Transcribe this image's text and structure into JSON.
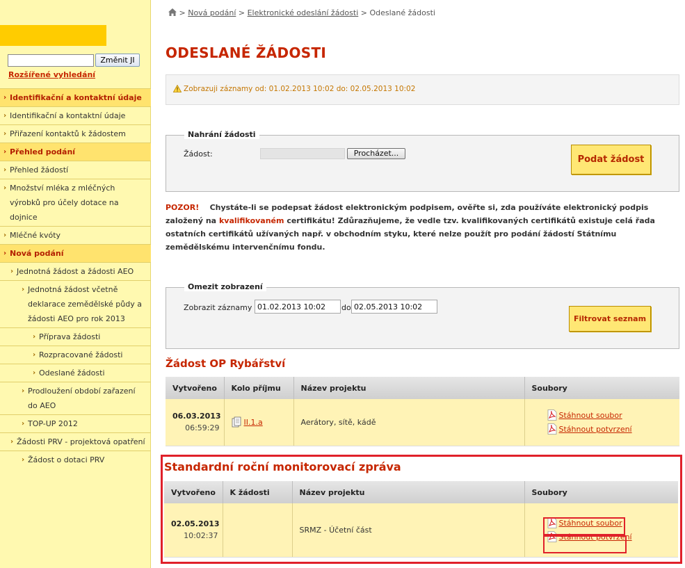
{
  "sidebar": {
    "search_value": "",
    "search_button": "Změnit JI",
    "advanced_search": "Rozšířené vyhledání",
    "menu": [
      {
        "label": "Identifikační a kontaktní údaje",
        "type": "head",
        "indent": 0
      },
      {
        "label": "Identifikační a kontaktní údaje",
        "type": "item",
        "indent": 0
      },
      {
        "label": "Přiřazení kontaktů k žádostem",
        "type": "item",
        "indent": 0
      },
      {
        "label": "Přehled podání",
        "type": "head",
        "indent": 0
      },
      {
        "label": "Přehled žádostí",
        "type": "item",
        "indent": 0
      },
      {
        "label": "Množství mléka z mléčných výrobků pro účely dotace na dojnice",
        "type": "item",
        "indent": 0
      },
      {
        "label": "Mléčné kvóty",
        "type": "item",
        "indent": 0
      },
      {
        "label": "Nová podání",
        "type": "head",
        "indent": 0
      },
      {
        "label": "Jednotná žádost a žádosti AEO",
        "type": "item",
        "indent": 1
      },
      {
        "label": "Jednotná žádost včetně deklarace zemědělské půdy a žádosti AEO pro rok 2013",
        "type": "item",
        "indent": 2
      },
      {
        "label": "Příprava žádosti",
        "type": "item",
        "indent": 3
      },
      {
        "label": "Rozpracované žádosti",
        "type": "item",
        "indent": 3
      },
      {
        "label": "Odeslané žádosti",
        "type": "item",
        "indent": 3
      },
      {
        "label": "Prodloužení období zařazení do AEO",
        "type": "item",
        "indent": 2
      },
      {
        "label": "TOP-UP 2012",
        "type": "item",
        "indent": 2
      },
      {
        "label": "Žádosti PRV - projektová opatření",
        "type": "item",
        "indent": 1
      },
      {
        "label": "Žádost o dotaci PRV",
        "type": "item",
        "indent": 2
      }
    ]
  },
  "breadcrumb": {
    "items": [
      "Nová podání",
      "Elektronické odeslání žádosti"
    ],
    "current": "Odeslané žádosti",
    "separator": ">"
  },
  "page_title": "ODESLANÉ ŽÁDOSTI",
  "notice": "Zobrazuji záznamy od: 01.02.2013 10:02 do: 02.05.2013 10:02",
  "upload": {
    "legend": "Nahrání žádosti",
    "field_label": "Žádost:",
    "browse_button": "Procházet...",
    "submit_button": "Podat žádost"
  },
  "warning": {
    "prefix": "POZOR!",
    "part1": "Chystáte-li se podepsat žádost elektronickým podpisem, ověřte si, zda používáte elektronický podpis založený na",
    "highlight": "kvalifikovaném",
    "part2": "certifikátu! Zdůrazňujeme, že vedle tzv. kvalifikovaných certifikátů existuje celá řada ostatních certifikátů užívaných např. v obchodním styku, které nelze použít pro podání žádostí Státnímu zemědělskému intervenčnímu fondu."
  },
  "filter": {
    "legend": "Omezit zobrazení",
    "label_from": "Zobrazit záznamy od",
    "from_value": "01.02.2013 10:02",
    "label_to": "do",
    "to_value": "02.05.2013 10:02",
    "button": "Filtrovat seznam"
  },
  "section1": {
    "title": "Žádost OP Rybářství",
    "columns": [
      "Vytvořeno",
      "Kolo příjmu",
      "Název projektu",
      "Soubory"
    ],
    "row": {
      "date": "06.03.2013",
      "time": "06:59:29",
      "round": "II.1.a",
      "project": "Aerátory, sítě, kádě",
      "files": [
        "Stáhnout soubor",
        "Stáhnout potvrzení"
      ]
    }
  },
  "section2": {
    "title": "Standardní roční monitorovací zpráva",
    "columns": [
      "Vytvořeno",
      "K žádosti",
      "Název projektu",
      "Soubory"
    ],
    "row": {
      "date": "02.05.2013",
      "time": "10:02:37",
      "request": "",
      "project": "SRMZ - Účetní část",
      "files": [
        "Stáhnout soubor",
        "Stáhnout potvrzení"
      ]
    }
  },
  "colors": {
    "accent_red": "#c62600",
    "sidebar_bg": "#fff9b0",
    "sidebar_head": "#ffe36e",
    "button_yellow": "#ffe774",
    "highlight_red": "#e0202a"
  },
  "icons": [
    "home-icon",
    "warning-icon",
    "pdf-icon",
    "document-icon",
    "chevron-right-icon"
  ]
}
